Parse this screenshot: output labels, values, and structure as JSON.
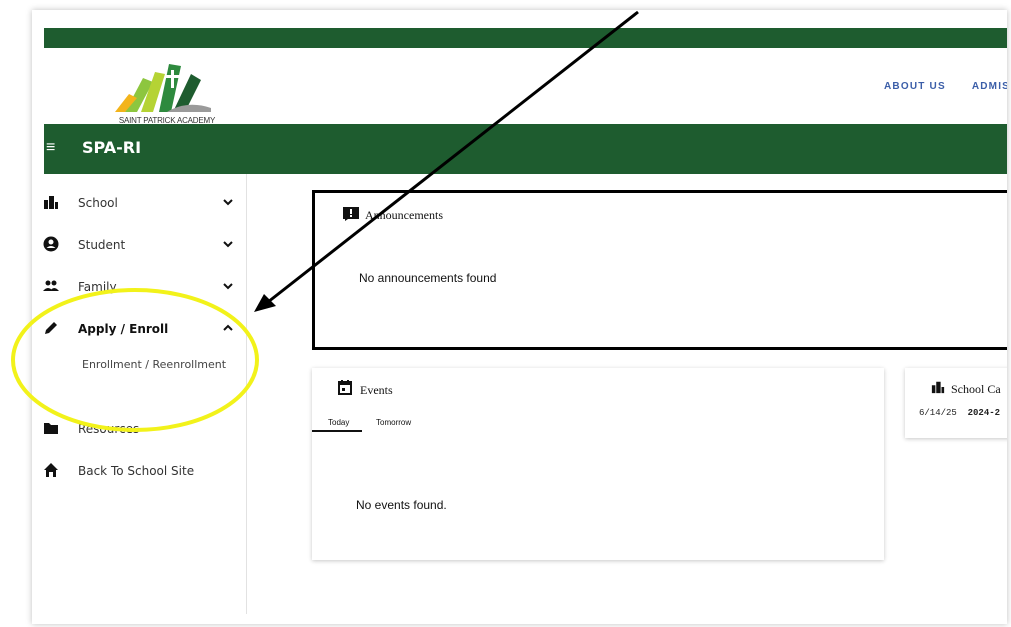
{
  "header": {
    "logo_text": "SAINT PATRICK ACADEMY",
    "nav_links": [
      "ABOUT US",
      "ADMIS"
    ],
    "app_title": "SPA-RI"
  },
  "sidebar": {
    "items": [
      {
        "label": "School",
        "icon": "building-icon",
        "chevron": "down"
      },
      {
        "label": "Student",
        "icon": "account-circle-icon",
        "chevron": "down"
      },
      {
        "label": "Family",
        "icon": "people-icon",
        "chevron": "down"
      },
      {
        "label": "Apply / Enroll",
        "icon": "pencil-icon",
        "chevron": "up"
      },
      {
        "label": "Resources",
        "icon": "folder-icon"
      },
      {
        "label": "Back To School Site",
        "icon": "home-icon"
      }
    ],
    "sub_item": "Enrollment / Reenrollment"
  },
  "announcements": {
    "title": "Announcements",
    "empty": "No announcements found"
  },
  "events": {
    "title": "Events",
    "tabs": [
      "Today",
      "Tomorrow"
    ],
    "empty": "No events found."
  },
  "calendar": {
    "title": "School Ca",
    "date": "6/14/25",
    "year": "2024-2"
  },
  "colors": {
    "brand_green": "#1e5c2f",
    "link_blue": "#3b5ea8",
    "highlight_yellow": "#f2f21a"
  }
}
